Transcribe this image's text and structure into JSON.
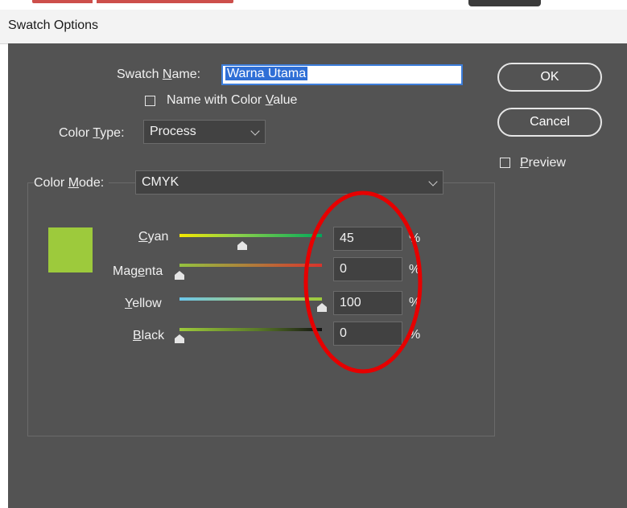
{
  "window": {
    "title": "Swatch Options"
  },
  "swatch_name": {
    "label": "Swatch Name:",
    "value": "Warna Utama"
  },
  "name_with_color_value": {
    "label": "Name with Color Value",
    "checked": false
  },
  "color_type": {
    "label": "Color Type:",
    "value": "Process"
  },
  "color_mode": {
    "label": "Color Mode:",
    "value": "CMYK"
  },
  "buttons": {
    "ok": "OK",
    "cancel": "Cancel"
  },
  "preview": {
    "label": "Preview",
    "checked": false
  },
  "swatch_color": "#9dca3c",
  "channels": [
    {
      "label": "Cyan",
      "value": "45",
      "unit": "%",
      "fraction": 0.45
    },
    {
      "label": "Magenta",
      "value": "0",
      "unit": "%",
      "fraction": 0
    },
    {
      "label": "Yellow",
      "value": "100",
      "unit": "%",
      "fraction": 1.0
    },
    {
      "label": "Black",
      "value": "0",
      "unit": "%",
      "fraction": 0
    }
  ],
  "colors": {
    "annotation": "#e60000",
    "selection": "#2f6fd6"
  }
}
